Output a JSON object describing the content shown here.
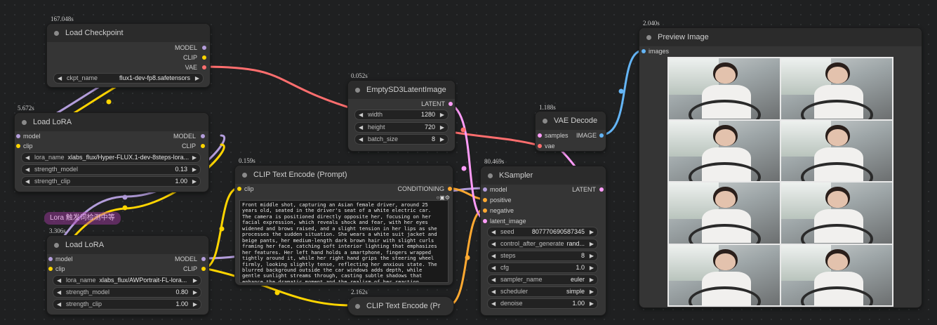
{
  "colors": {
    "model": "#b39ddb",
    "clip": "#ffd500",
    "vae": "#ff6e6e",
    "latent": "#ff9cf9",
    "conditioning": "#ffa931",
    "image": "#64b5f6"
  },
  "nodes": {
    "load_checkpoint": {
      "time": "167.048s",
      "title": "Load Checkpoint",
      "out_model": "MODEL",
      "out_clip": "CLIP",
      "out_vae": "VAE",
      "ckpt_label": "ckpt_name",
      "ckpt_value": "flux1-dev-fp8.safetensors"
    },
    "lora1": {
      "time": "5.672s",
      "title": "Load LoRA",
      "in_model": "model",
      "in_clip": "clip",
      "out_model": "MODEL",
      "out_clip": "CLIP",
      "lora_label": "lora_name",
      "lora_value": "xlabs_flux/Hyper-FLUX.1-dev-8steps-lora...",
      "sm_label": "strength_model",
      "sm_value": "0.13",
      "sc_label": "strength_clip",
      "sc_value": "1.00"
    },
    "group_tag": "Lora 触发词检测中等",
    "lora2": {
      "time": "3.306s",
      "title": "Load LoRA",
      "in_model": "model",
      "in_clip": "clip",
      "out_model": "MODEL",
      "out_clip": "CLIP",
      "lora_label": "lora_name",
      "lora_value": "xlabs_flux/AWPortrait-FL-lora...",
      "sm_label": "strength_model",
      "sm_value": "0.80",
      "sc_label": "strength_clip",
      "sc_value": "1.00"
    },
    "clip_encode": {
      "time": "0.159s",
      "title": "CLIP Text Encode (Prompt)",
      "in_clip": "clip",
      "out": "CONDITIONING",
      "prompt": "Front middle shot, capturing an Asian female driver, around 25\nyears old, seated in the driver's seat of a white electric car.\nThe camera is positioned directly opposite her, focusing on her\nfacial expression, which reveals shock and fear, with her eyes\nwidened and brows raised, and a slight tension in her lips as she\nprocesses the sudden situation. She wears a white suit jacket and\nbeige pants, her medium-length dark brown hair with slight curls\nframing her face, catching soft interior lighting that emphasizes\nher features. Her left hand holds a smartphone, fingers wrapped\ntightly around it, while her right hand grips the steering wheel\nfirmly, looking slightly tense, reflecting her anxious state. The\nblurred background outside the car windows adds depth, while\ngentle sunlight streams through, casting subtle shadows that\nenhance the dramatic moment and the realism of her reaction."
    },
    "empty_latent": {
      "time": "0.052s",
      "title": "EmptySD3LatentImage",
      "out": "LATENT",
      "width_label": "width",
      "width_value": "1280",
      "height_label": "height",
      "height_value": "720",
      "batch_label": "batch_size",
      "batch_value": "8"
    },
    "clip_encode2": {
      "time": "2.162s",
      "title": "CLIP Text Encode (Pr"
    },
    "vae_decode": {
      "time": "1.188s",
      "title": "VAE Decode",
      "in_samples": "samples",
      "in_vae": "vae",
      "out": "IMAGE"
    },
    "ksampler": {
      "time": "80.469s",
      "title": "KSampler",
      "in_model": "model",
      "in_positive": "positive",
      "in_negative": "negative",
      "in_latent": "latent_image",
      "out": "LATENT",
      "widgets": [
        {
          "label": "seed",
          "value": "807770690587345"
        },
        {
          "label": "control_after_generate",
          "value": "rand..."
        },
        {
          "label": "steps",
          "value": "8"
        },
        {
          "label": "cfg",
          "value": "1.0"
        },
        {
          "label": "sampler_name",
          "value": "euler"
        },
        {
          "label": "scheduler",
          "value": "simple"
        },
        {
          "label": "denoise",
          "value": "1.00"
        }
      ]
    },
    "preview": {
      "time": "2.040s",
      "title": "Preview Image",
      "in_images": "images"
    }
  },
  "arrows": {
    "left": "◀",
    "right": "▶"
  }
}
